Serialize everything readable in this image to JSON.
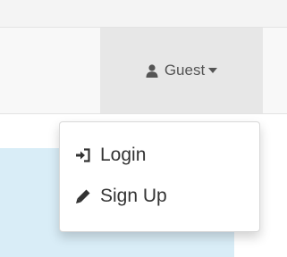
{
  "navbar": {
    "user_menu": {
      "label": "Guest",
      "icon": "user-icon",
      "caret_icon": "caret-down-icon"
    }
  },
  "dropdown": {
    "items": [
      {
        "label": "Login",
        "icon": "sign-in-icon"
      },
      {
        "label": "Sign Up",
        "icon": "pencil-icon"
      }
    ]
  },
  "colors": {
    "navbar_bg": "#f8f8f8",
    "active_item_bg": "#e7e7e7",
    "text": "#333333",
    "panel_bg": "#d9edf7"
  }
}
